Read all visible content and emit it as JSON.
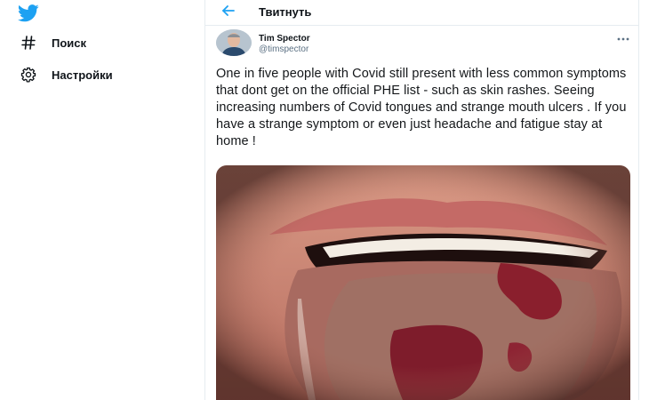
{
  "app": {
    "brand_color": "#1da1f2"
  },
  "sidebar": {
    "logo_icon": "twitter-bird-icon",
    "items": [
      {
        "label": "Поиск",
        "icon": "hashtag-icon"
      },
      {
        "label": "Настройки",
        "icon": "gear-icon"
      }
    ]
  },
  "header": {
    "back_icon": "arrow-left-icon",
    "title": "Твитнуть"
  },
  "tweet": {
    "author": {
      "name": "Tim Spector",
      "handle": "@timspector"
    },
    "more_icon": "more-horizontal-icon",
    "text": "One in five people with Covid still present with less common symptoms that dont get on the official PHE list - such as skin rashes. Seeing increasing numbers of Covid tongues and strange mouth ulcers . If you have a strange symptom or even just headache and fatigue stay at home !",
    "media": {
      "type": "photo"
    }
  }
}
